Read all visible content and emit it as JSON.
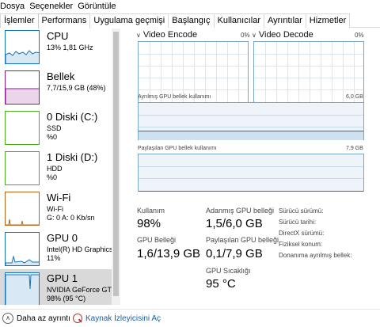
{
  "menu": {
    "file": "Dosya",
    "options": "Seçenekler",
    "view": "Görüntüle"
  },
  "tabs": [
    {
      "label": "İşlemler"
    },
    {
      "label": "Performans"
    },
    {
      "label": "Uygulama geçmişi"
    },
    {
      "label": "Başlangıç"
    },
    {
      "label": "Kullanıcılar"
    },
    {
      "label": "Ayrıntılar"
    },
    {
      "label": "Hizmetler"
    }
  ],
  "sidebar": {
    "items": [
      {
        "name": "CPU",
        "line1": "13%  1,81 GHz",
        "line2": "",
        "color": "#1773b8"
      },
      {
        "name": "Bellek",
        "line1": "7,7/15,9 GB (48%)",
        "line2": "",
        "color": "#8b1a8b"
      },
      {
        "name": "0 Diski (C:)",
        "line1": "SSD",
        "line2": "%0",
        "color": "#4caf20"
      },
      {
        "name": "1 Diski (D:)",
        "line1": "HDD",
        "line2": "%0",
        "color": "#4caf20"
      },
      {
        "name": "Wi-Fi",
        "line1": "Wi-Fi",
        "line2": "G: 0  A: 0 Kb/sn",
        "color": "#b8641b"
      },
      {
        "name": "GPU 0",
        "line1": "Intel(R) HD Graphics",
        "line2": "11%",
        "color": "#1773b8"
      },
      {
        "name": "GPU 1",
        "line1": "NVIDIA GeForce GTX",
        "line2": "98%  (95 °C)",
        "color": "#1773b8"
      }
    ]
  },
  "graphs": {
    "video_encode": {
      "title": "Video Encode",
      "pct": "0%"
    },
    "video_decode": {
      "title": "Video Decode",
      "pct": "0%"
    },
    "dedicated": {
      "label": "Ayrılmış GPU bellek kullanımı",
      "max": "6,0 GB"
    },
    "shared": {
      "label": "Paylaşılan GPU bellek kullanımı",
      "max": "7,9 GB"
    }
  },
  "stats": {
    "usage_label": "Kullanım",
    "usage_value": "98%",
    "dedicated_label": "Adanmış GPU belleği",
    "dedicated_value": "1,5/6,0 GB",
    "gpu_mem_label": "GPU Belleği",
    "gpu_mem_value": "1,6/13,9 GB",
    "shared_label": "Paylaşılan GPU belleği",
    "shared_value": "0,1/7,9 GB",
    "temp_label": "GPU Sıcaklığı",
    "temp_value": "95 °C"
  },
  "info": {
    "driver_version": "Sürücü sürümü:",
    "driver_date": "Sürücü tarihi:",
    "directx": "DirectX sürümü:",
    "physical_location": "Fiziksel konum:",
    "hw_reserved": "Donanıma ayrılmış bellek:"
  },
  "footer": {
    "fewer_details": "Daha az ayrıntı",
    "open_monitor": "Kaynak İzleyicisini Aç"
  }
}
